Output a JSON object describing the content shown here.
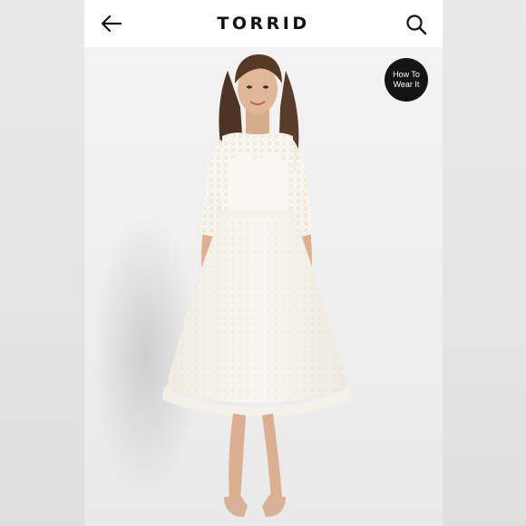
{
  "header": {
    "brand": "TORRID",
    "back_icon": "arrow-left-icon",
    "search_icon": "search-icon"
  },
  "product": {
    "badge_line1": "How To",
    "badge_line2": "Wear It",
    "image_subject": "model-in-white-lace-midi-dress"
  },
  "colors": {
    "header_bg": "#ffffff",
    "photo_bg": "#f1f1f1",
    "badge_bg": "#141414",
    "dress": "#f7f5ee"
  }
}
